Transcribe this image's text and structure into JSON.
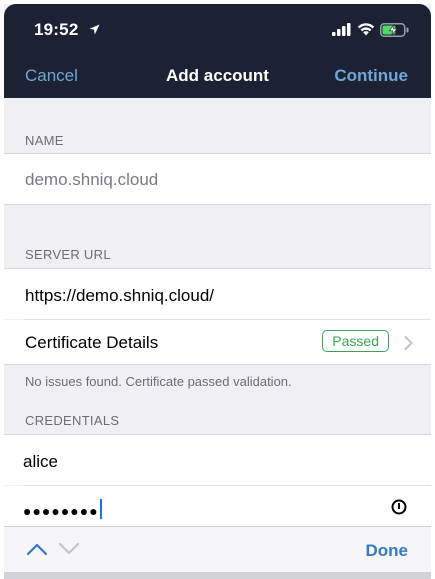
{
  "status_bar": {
    "time": "19:52"
  },
  "nav": {
    "cancel": "Cancel",
    "title": "Add account",
    "continue": "Continue"
  },
  "name_section": {
    "header": "NAME",
    "value": "demo.shniq.cloud"
  },
  "server_section": {
    "header": "SERVER URL",
    "url": "https://demo.shniq.cloud/",
    "cert_label": "Certificate Details",
    "cert_status": "Passed",
    "footer": "No issues found. Certificate passed validation."
  },
  "credentials_section": {
    "header": "CREDENTIALS",
    "username": "alice",
    "password_masked": "●●●●●●●●"
  },
  "toolbar": {
    "done": "Done"
  },
  "colors": {
    "nav_bg": "#1c2234",
    "nav_button": "#6ea6d8",
    "badge_green": "#3aa655",
    "done_blue": "#3478c6"
  }
}
